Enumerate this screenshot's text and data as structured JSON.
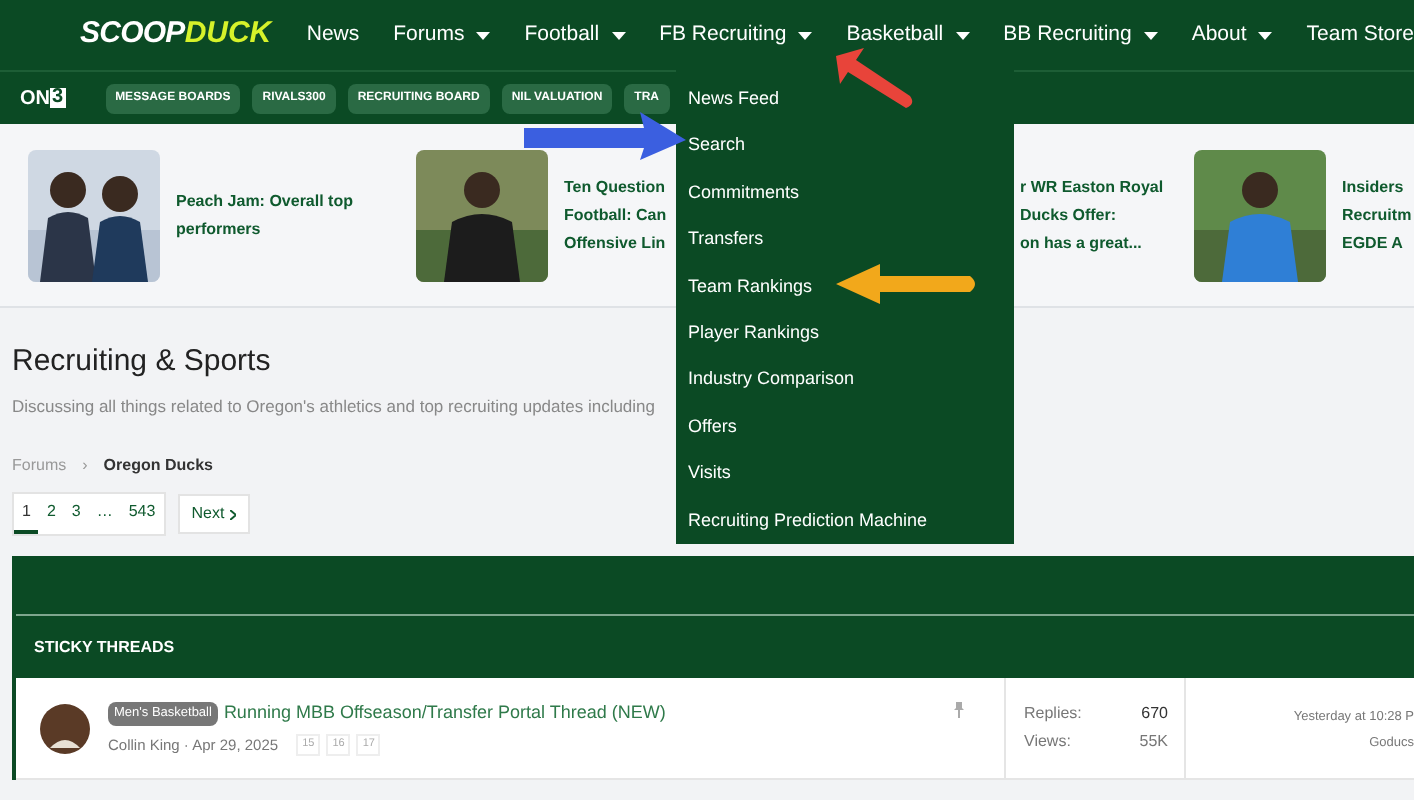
{
  "header": {
    "logo": [
      "SCOOP",
      "DUCK"
    ],
    "nav": [
      {
        "label": "News",
        "dropdown": false
      },
      {
        "label": "Forums",
        "dropdown": true
      },
      {
        "label": "Football",
        "dropdown": true
      },
      {
        "label": "FB Recruiting",
        "dropdown": true
      },
      {
        "label": "Basketball",
        "dropdown": true
      },
      {
        "label": "BB Recruiting",
        "dropdown": true
      },
      {
        "label": "About",
        "dropdown": true
      },
      {
        "label": "Team Store",
        "dropdown": false
      }
    ]
  },
  "subnav": {
    "brand": [
      "ON",
      "3"
    ],
    "tags": [
      "MESSAGE BOARDS",
      "RIVALS300",
      "RECRUITING BOARD",
      "NIL VALUATION",
      "TRA"
    ]
  },
  "carousel": [
    {
      "lines": [
        "Peach Jam: Overall top",
        "performers"
      ]
    },
    {
      "lines": [
        "Ten Question",
        "Football: Can",
        "Offensive Lin"
      ]
    },
    {
      "lines": [
        "r WR Easton Royal",
        "Ducks Offer:",
        "on has a great..."
      ]
    },
    {
      "lines": [
        "Insiders",
        "Recruitm",
        "EGDE A"
      ]
    }
  ],
  "dropdown": {
    "items": [
      "News Feed",
      "Search",
      "Commitments",
      "Transfers",
      "Team Rankings",
      "Player Rankings",
      "Industry Comparison",
      "Offers",
      "Visits",
      "Recruiting Prediction Machine"
    ]
  },
  "page": {
    "title": "Recruiting & Sports",
    "description": "Discussing all things related to Oregon's athletics and top recruiting updates including",
    "breadcrumb": [
      {
        "label": "Forums",
        "current": false
      },
      {
        "label": "Oregon Ducks",
        "current": true
      }
    ],
    "separator": "›",
    "pages": [
      {
        "label": "1",
        "selected": true
      },
      {
        "label": "2",
        "selected": false
      },
      {
        "label": "3",
        "selected": false
      },
      {
        "label": "…",
        "selected": false
      },
      {
        "label": "543",
        "selected": false
      }
    ],
    "next": "Next"
  },
  "threads": {
    "section": "STICKY THREADS",
    "rows": [
      {
        "tag": "Men's Basketball",
        "title": "Running MBB Offseason/Transfer Portal Thread (NEW)",
        "meta": "Collin King · Apr 29, 2025",
        "pages": [
          "15",
          "16",
          "17"
        ],
        "replies_label": "Replies:",
        "replies": "670",
        "views_label": "Views:",
        "views": "55K",
        "last_date": "Yesterday at 10:28 P",
        "last_user": "Goducs"
      }
    ]
  }
}
